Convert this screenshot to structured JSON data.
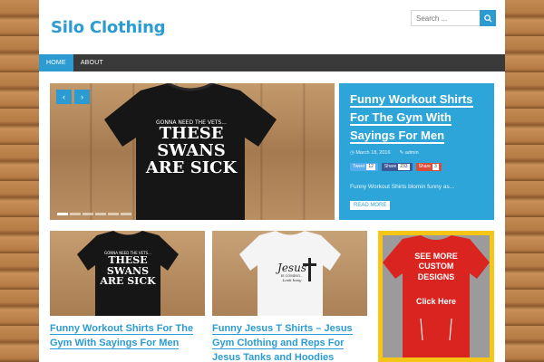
{
  "header": {
    "site_title": "Silo Clothing",
    "search_placeholder": "Search ..."
  },
  "nav": {
    "items": [
      {
        "label": "HOME",
        "active": true
      },
      {
        "label": "ABOUT",
        "active": false
      }
    ]
  },
  "slider": {
    "shirt_text": [
      "GONNA NEED THE VETS...",
      "THESE",
      "SWANS",
      "ARE SICK"
    ],
    "dots_count": 6,
    "active_dot": 0
  },
  "featured": {
    "title": "Funny Workout Shirts For The Gym With Sayings For Men",
    "date": "March 18, 2016",
    "author": "admin",
    "share": [
      {
        "label": "Tweet",
        "count": "12",
        "color": "#55acee"
      },
      {
        "label": "Share",
        "count": "233",
        "color": "#3b5998"
      },
      {
        "label": "Share",
        "count": "3",
        "color": "#dd4b39"
      }
    ],
    "excerpt": "Funny Workout Shirts blomin funny as...",
    "read_more": "READ MORE"
  },
  "cards": [
    {
      "title": "Funny Workout Shirts For The Gym With Sayings For Men",
      "shirt_text": [
        "GONNA NEED THE VETS...",
        "THESE",
        "SWANS",
        "ARE SICK"
      ]
    },
    {
      "title": "Funny Jesus T Shirts – Jesus Gym Clothing and Reps For Jesus Tanks and Hoodies",
      "shirt_text": [
        "Jesus",
        "IS COMING...",
        "Look busy"
      ]
    }
  ],
  "ad": {
    "line1": "SEE MORE",
    "line2": "CUSTOM",
    "line3": "DESIGNS",
    "cta": "Click Here"
  },
  "colors": {
    "accent": "#2b9bd1",
    "nav": "#3a3a3a",
    "ad_border": "#f5c518",
    "shirt_red": "#d9241f"
  }
}
